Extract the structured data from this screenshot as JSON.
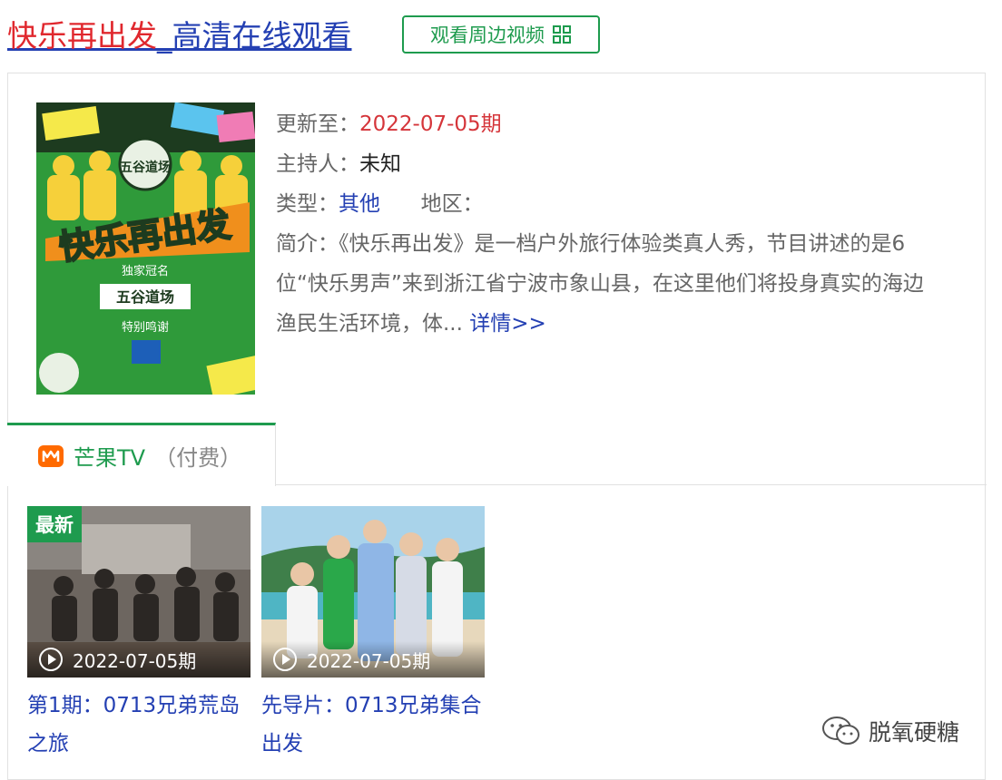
{
  "header": {
    "title_highlight": "快乐再出发",
    "title_rest": "_高清在线观看",
    "peripheral_button": "观看周边视频"
  },
  "info": {
    "update_label": "更新至：",
    "update_value": "2022-07-05期",
    "host_label": "主持人：",
    "host_value": "未知",
    "type_label": "类型：",
    "type_value": "其他",
    "region_label": "地区：",
    "region_value": "",
    "desc_label": "简介：",
    "desc_text": "《快乐再出发》是一档户外旅行体验类真人秀，节目讲述的是6位“快乐男声”来到浙江省宁波市象山县，在这里他们将投身真实的海边渔民生活环境，体...",
    "more_link": "详情>>"
  },
  "poster": {
    "sponsor_logo": "五谷道场",
    "show_logo": "快乐再出发",
    "credit_line1": "独家冠名",
    "credit_brand": "五谷道场",
    "credit_line2": "特别鸣谢"
  },
  "tabs": [
    {
      "name": "芒果TV",
      "extra": "（付费）",
      "icon": "mango-tv-icon",
      "active": true
    }
  ],
  "episodes": [
    {
      "badge": "最新",
      "date": "2022-07-05期",
      "title": "第1期：0713兄弟荒岛之旅"
    },
    {
      "badge": "",
      "date": "2022-07-05期",
      "title": "先导片：0713兄弟集合出发"
    }
  ],
  "watermark": {
    "text": "脱氧硬糖",
    "icon": "wechat-icon"
  },
  "colors": {
    "accent_green": "#1e9b4e",
    "link_blue": "#2440b3",
    "highlight_red": "#e0282e",
    "date_red": "#d5353a",
    "mango_orange": "#ff6a00"
  }
}
